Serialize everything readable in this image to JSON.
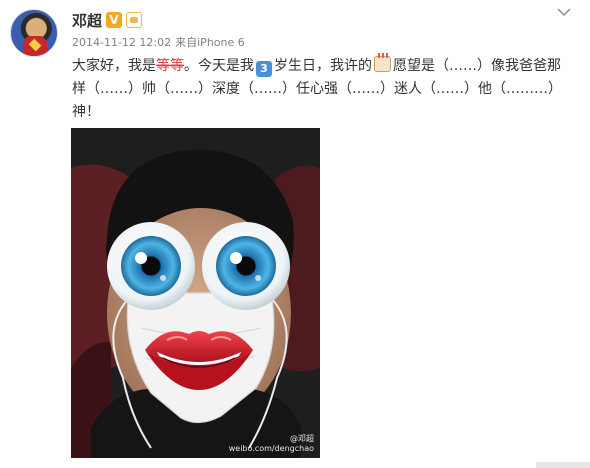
{
  "user": {
    "name": "邓超",
    "vip_badge": "V"
  },
  "meta": {
    "timestamp": "2014-11-12 12:02",
    "source_prefix": "来自",
    "source": "iPhone 6"
  },
  "post": {
    "t1": "大家好，我是",
    "struck": "等等",
    "t2": "。今天是我",
    "emoji_number": "3",
    "t3": "岁生日，我许的",
    "t4": "愿望是（……）像我爸爸那样（……）帅（……）深度（……）任心强（……）迷人（……）他（………）神！"
  },
  "image": {
    "watermark_handle": "@邓超",
    "watermark_url": "weibo.com/dengchao",
    "description": "selfie with cartoon eyes and lips over a white face mask"
  },
  "icons": {
    "more": "chevron-down-icon",
    "vip": "verified-v-icon",
    "member": "member-crown-icon",
    "number_emoji": "keycap-3-icon",
    "cake": "birthday-cake-icon",
    "weibo": "weibo-logo-icon"
  },
  "colors": {
    "name": "#333333",
    "meta": "#808080",
    "strike": "#e4393c",
    "vip": "#f5a623",
    "keycap": "#4a90d9"
  }
}
